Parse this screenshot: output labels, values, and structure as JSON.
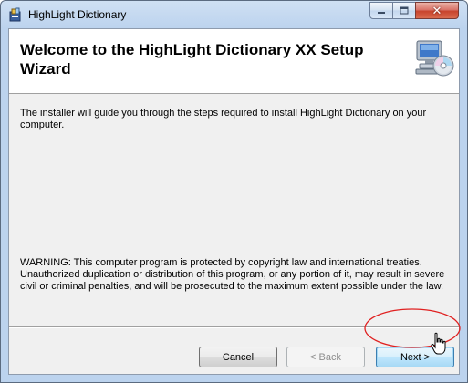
{
  "window": {
    "title": "HighLight Dictionary",
    "icon": "installer-app-icon",
    "controls": {
      "minimize": "minimize-icon",
      "maximize": "maximize-icon",
      "close": "close-icon"
    }
  },
  "header": {
    "heading": "Welcome to the HighLight Dictionary XX Setup Wizard",
    "icon": "computer-cd-icon"
  },
  "content": {
    "intro": "The installer will guide you through the steps required to install HighLight Dictionary on your computer.",
    "warning": "WARNING: This computer program is protected by copyright law and international treaties. Unauthorized duplication or distribution of this program, or any portion of it, may result in severe civil or criminal penalties, and will be prosecuted to the maximum extent possible under the law."
  },
  "buttons": {
    "cancel": "Cancel",
    "back": "< Back",
    "next": "Next >"
  },
  "annotation": {
    "highlight_color": "#e02020",
    "cursor": "hand-pointer-cursor"
  }
}
